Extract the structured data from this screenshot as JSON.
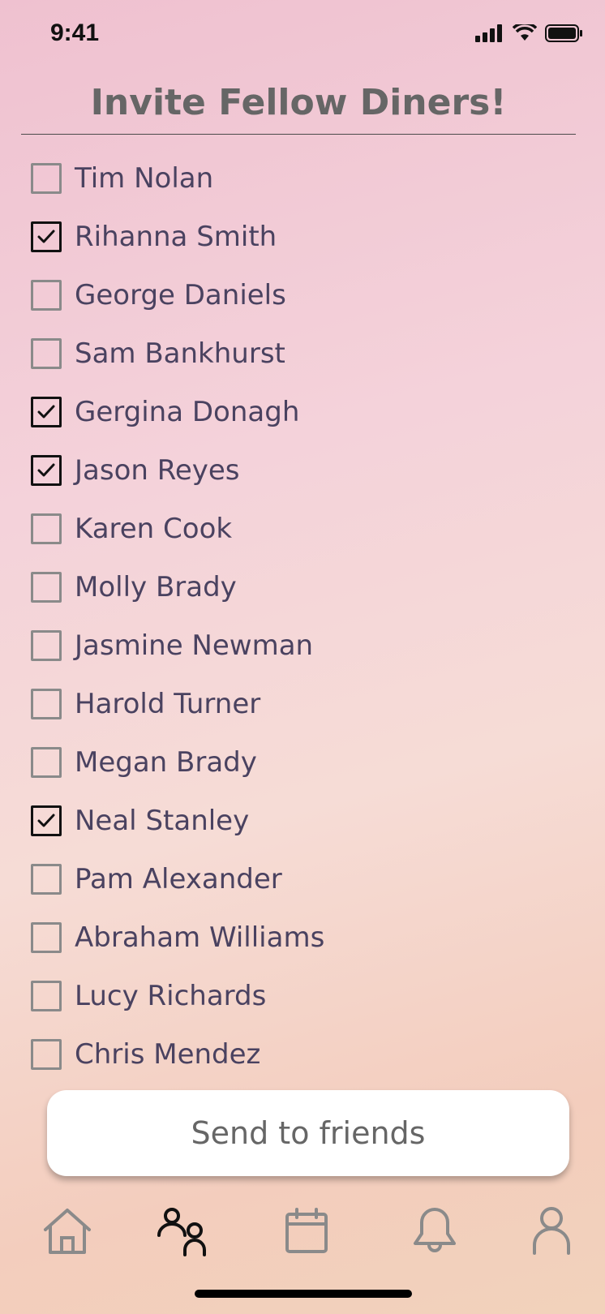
{
  "status_bar": {
    "time": "9:41"
  },
  "title": "Invite Fellow Diners!",
  "friends": [
    {
      "name": "Tim Nolan",
      "checked": false
    },
    {
      "name": "Rihanna Smith",
      "checked": true
    },
    {
      "name": "George Daniels",
      "checked": false
    },
    {
      "name": "Sam Bankhurst",
      "checked": false
    },
    {
      "name": "Gergina Donagh",
      "checked": true
    },
    {
      "name": "Jason Reyes",
      "checked": true
    },
    {
      "name": "Karen Cook",
      "checked": false
    },
    {
      "name": "Molly Brady",
      "checked": false
    },
    {
      "name": "Jasmine Newman",
      "checked": false
    },
    {
      "name": "Harold Turner",
      "checked": false
    },
    {
      "name": "Megan Brady",
      "checked": false
    },
    {
      "name": "Neal Stanley",
      "checked": true
    },
    {
      "name": "Pam Alexander",
      "checked": false
    },
    {
      "name": "Abraham Williams",
      "checked": false
    },
    {
      "name": "Lucy Richards",
      "checked": false
    },
    {
      "name": "Chris Mendez",
      "checked": false
    }
  ],
  "send_button": {
    "label": "Send to friends"
  },
  "tabs": [
    {
      "icon": "home-icon",
      "active": false
    },
    {
      "icon": "friends-icon",
      "active": true
    },
    {
      "icon": "calendar-icon",
      "active": false
    },
    {
      "icon": "bell-icon",
      "active": false
    },
    {
      "icon": "profile-icon",
      "active": false
    }
  ],
  "colors": {
    "inactive_icon": "#8a8a8a",
    "active_icon": "#111111",
    "name_text": "#4a4260"
  }
}
